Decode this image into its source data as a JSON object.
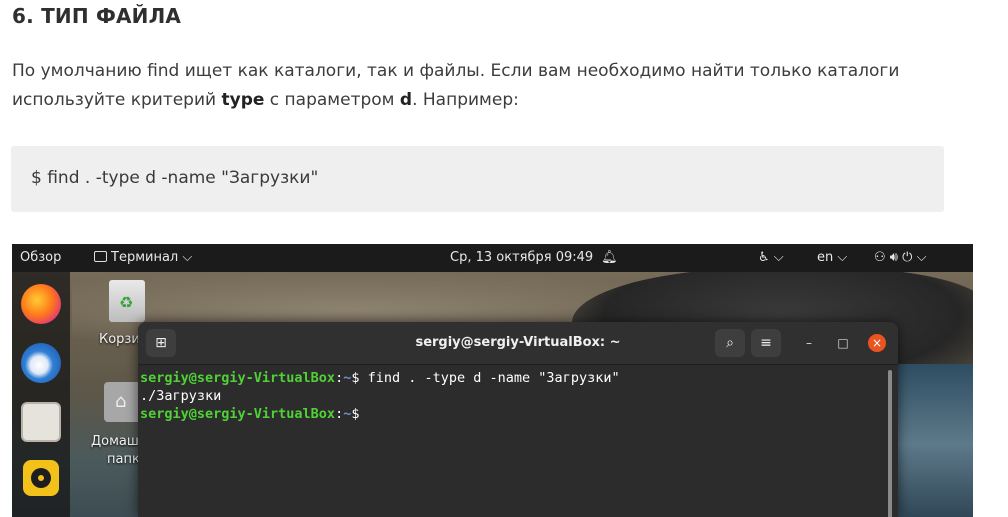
{
  "article": {
    "heading": "6. ТИП ФАЙЛА",
    "para_1": "По умолчанию find ищет как каталоги, так и файлы. Если вам необходимо найти только каталоги используйте критерий ",
    "para_type": "type",
    "para_2": " с параметром ",
    "para_d": "d",
    "para_3": ". Например:",
    "code": "$ find . -type d -name \"Загрузки\""
  },
  "topbar": {
    "overview": "Обзор",
    "app_menu": "Терминал",
    "datetime": "Ср, 13 октября  09:49",
    "language": "en"
  },
  "desktop": {
    "trash_label": "Корзи",
    "home_label_1": "Домаш",
    "home_label_2": "папк"
  },
  "terminal": {
    "title": "sergiy@sergiy-VirtualBox: ~",
    "prompt_user": "sergiy@sergiy-VirtualBox",
    "prompt_sep": ":",
    "prompt_path": "~",
    "prompt_dollar": "$ ",
    "command": "find . -type d -name \"Загрузки\"",
    "output_line": "./Загрузки"
  },
  "colors": {
    "prompt_green": "#4fd235",
    "prompt_blue": "#6d8fd0",
    "close_orange": "#e95420"
  }
}
